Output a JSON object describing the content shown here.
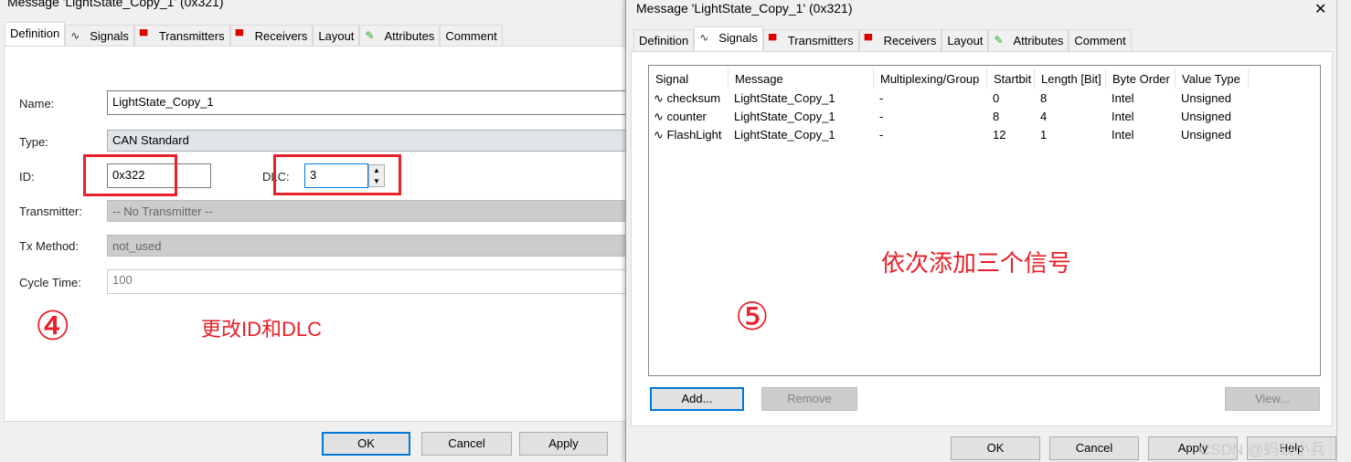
{
  "left": {
    "title": "Message 'LightState_Copy_1' (0x321)",
    "tabs": [
      {
        "label": "Definition",
        "icon": ""
      },
      {
        "label": "Signals",
        "icon": "signal-wave-icon"
      },
      {
        "label": "Transmitters",
        "icon": "transmitter-icon"
      },
      {
        "label": "Receivers",
        "icon": "receiver-icon"
      },
      {
        "label": "Layout",
        "icon": ""
      },
      {
        "label": "Attributes",
        "icon": "attributes-pencil-icon"
      },
      {
        "label": "Comment",
        "icon": ""
      }
    ],
    "active_tab": "Definition",
    "form": {
      "name_label": "Name:",
      "name_value": "LightState_Copy_1",
      "type_label": "Type:",
      "type_value": "CAN Standard",
      "id_label": "ID:",
      "id_value": "0x322",
      "dlc_label": "DLC:",
      "dlc_value": "3",
      "transmitter_label": "Transmitter:",
      "transmitter_value": "-- No Transmitter --",
      "txmethod_label": "Tx Method:",
      "txmethod_value": "not_used",
      "cycletime_label": "Cycle Time:",
      "cycletime_value": "100"
    },
    "annotation_number": "④",
    "annotation_text": "更改ID和DLC",
    "buttons": {
      "ok": "OK",
      "cancel": "Cancel",
      "apply": "Apply"
    }
  },
  "right": {
    "title": "Message 'LightState_Copy_1' (0x321)",
    "close": "✕",
    "tabs": [
      {
        "label": "Definition"
      },
      {
        "label": "Signals"
      },
      {
        "label": "Transmitters"
      },
      {
        "label": "Receivers"
      },
      {
        "label": "Layout"
      },
      {
        "label": "Attributes"
      },
      {
        "label": "Comment"
      }
    ],
    "active_tab": "Signals",
    "columns": [
      "Signal",
      "Message",
      "Multiplexing/Group",
      "Startbit",
      "Length [Bit]",
      "Byte Order",
      "Value Type"
    ],
    "rows": [
      [
        "checksum",
        "LightState_Copy_1",
        "-",
        "0",
        "8",
        "Intel",
        "Unsigned"
      ],
      [
        "counter",
        "LightState_Copy_1",
        "-",
        "8",
        "4",
        "Intel",
        "Unsigned"
      ],
      [
        "FlashLight",
        "LightState_Copy_1",
        "-",
        "12",
        "1",
        "Intel",
        "Unsigned"
      ]
    ],
    "annotation_number": "⑤",
    "annotation_text": "依次添加三个信号",
    "list_buttons": {
      "add": "Add...",
      "remove": "Remove",
      "view": "View..."
    },
    "buttons": {
      "ok": "OK",
      "cancel": "Cancel",
      "apply": "Apply",
      "help": "Help"
    }
  },
  "watermark": "CSDN @蚂蚁小兵",
  "colors": {
    "annotation": "#e8202a",
    "focus": "#0078d7"
  }
}
